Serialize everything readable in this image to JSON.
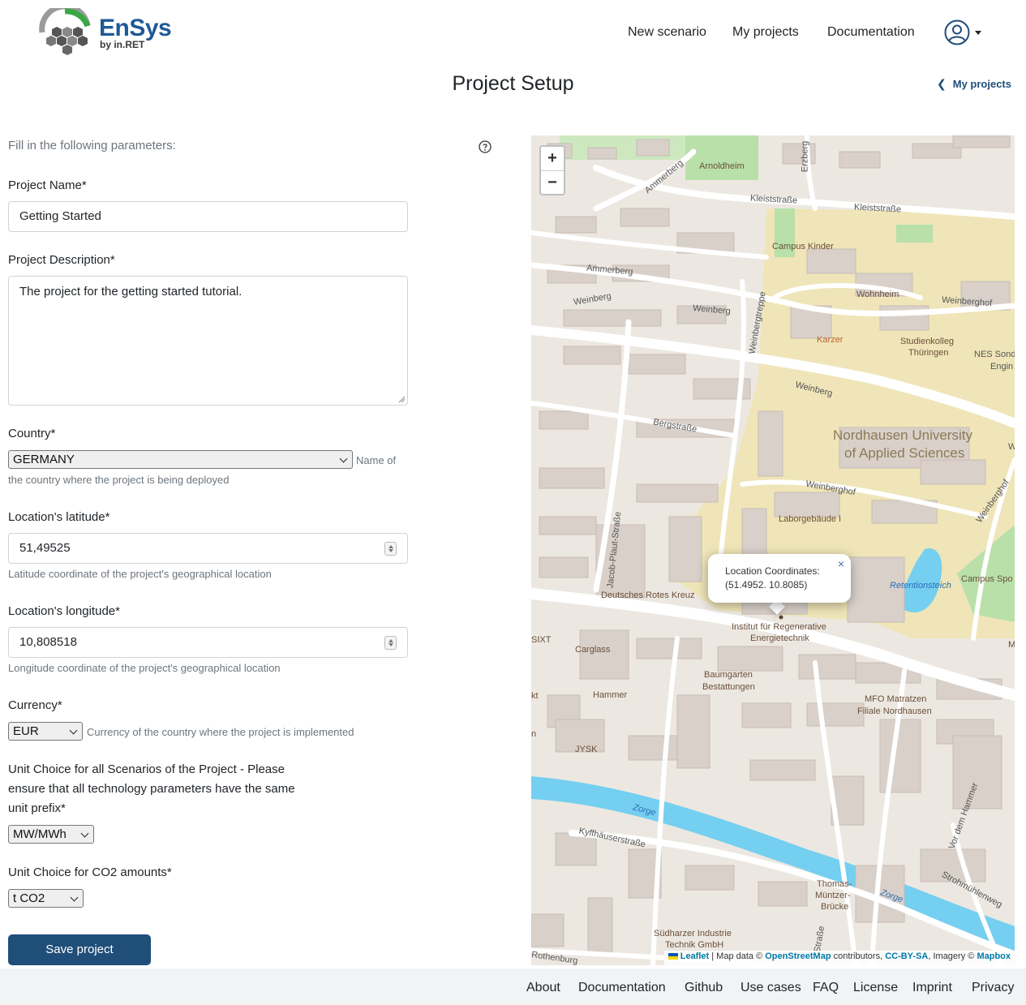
{
  "brand": {
    "name": "EnSys",
    "sub": "by in.RET"
  },
  "nav": {
    "new_scenario": "New scenario",
    "my_projects": "My projects",
    "documentation": "Documentation"
  },
  "page": {
    "title": "Project Setup",
    "back_link": "My projects"
  },
  "form": {
    "intro": "Fill in the following parameters:",
    "project_name": {
      "label": "Project Name*",
      "value": "Getting Started"
    },
    "project_description": {
      "label": "Project Description*",
      "value": "The project for the getting started tutorial."
    },
    "country": {
      "label": "Country*",
      "value": "GERMANY",
      "hint_1": "Name of",
      "hint_2": "the country where the project is being deployed"
    },
    "latitude": {
      "label": "Location's latitude*",
      "value": "51,49525",
      "hint": "Latitude coordinate of the project's geographical location"
    },
    "longitude": {
      "label": "Location's longitude*",
      "value": "10,808518",
      "hint": "Longitude coordinate of the project's geographical location"
    },
    "currency": {
      "label": "Currency*",
      "value": "EUR",
      "hint": "Currency of the country where the project is implemented"
    },
    "unit_choice": {
      "label_1": "Unit Choice for all Scenarios of the Project - Please",
      "label_2": "ensure that all technology parameters have the same",
      "label_3": "unit prefix*",
      "value": "MW/MWh"
    },
    "co2_unit": {
      "label": "Unit Choice for CO2 amounts*",
      "value": "t CO2"
    },
    "save_label": "Save project"
  },
  "map": {
    "zoom_in": "+",
    "zoom_out": "−",
    "popup_title": "Location Coordinates:",
    "popup_coords": "(51.4952. 10.8085)",
    "popup_close": "×",
    "attribution": {
      "leaflet": "Leaflet",
      "text_1": " | Map data © ",
      "osm": "OpenStreetMap",
      "text_2": " contributors, ",
      "license": "CC-BY-SA",
      "text_3": ", Imagery © ",
      "mapbox": "Mapbox"
    },
    "labels": {
      "arnoldheim": "Arnoldheim",
      "ammerberg_1": "Ammerberg",
      "ammerberg_2": "Ammerberg",
      "erzberg": "Erzberg",
      "kleiststrasse_1": "Kleiststraße",
      "kleiststrasse_2": "Kleiststraße",
      "campus_kinder": "Campus Kinder",
      "wohnheim": "Wohnheim",
      "weinberghof_1": "Weinberghof",
      "weinberg_1": "Weinberg",
      "weinberg_2": "Weinberg",
      "weinbergtreppe": "Weinbergtreppe",
      "karzer": "Karzer",
      "studienkolleg_1": "Studienkolleg",
      "studienkolleg_2": "Thüringen",
      "nes_1": "NES Sond",
      "nes_2": "Engin",
      "weinberg_3": "Weinberg",
      "bergstrasse": "Bergstraße",
      "university_1": "Nordhausen University",
      "university_2": "of Applied Sciences",
      "weinberghof_2": "Weinberghof",
      "weinberghof_3": "Weinberghof",
      "laborgebaeude": "Laborgebäude I",
      "jacob_plaut": "Jacob-Plaut-Straße",
      "drk": "Deutsches Rotes Kreuz",
      "retentionsteich": "Retentionsteich",
      "campus_sport": "Campus Spo",
      "institut_1": "Institut für Regenerative",
      "institut_2": "Energietechnik",
      "sixt": "SIXT",
      "carglass": "Carglass",
      "baumgarten_1": "Baumgarten",
      "baumgarten_2": "Bestattungen",
      "mfo_1": "MFO Matratzen",
      "mfo_2": "Filiale Nordhausen",
      "hammer": "Hammer",
      "jysk": "JYSK",
      "zorge_1": "Zorge",
      "zorge_2": "Zorge",
      "kyffhaeuser": "Kyffhäuserstraße",
      "vor_dem_hammer": "Vor dem Hammer",
      "strohmuehlenweg": "Strohmühlenweg",
      "thomas_1": "Thomas-",
      "thomas_2": "Müntzer-",
      "thomas_3": "Brücke",
      "suedharzer_1": "Südharzer Industrie",
      "suedharzer_2": "Technik GmbH",
      "rothenburg": "Rothenburg",
      "strasse": "Straße",
      "kt": "kt",
      "n": "n",
      "m": "M",
      "w": "W"
    }
  },
  "footer": {
    "about": "About",
    "documentation": "Documentation",
    "github": "Github",
    "use_cases": "Use cases",
    "faq": "FAQ",
    "license": "License",
    "imprint": "Imprint",
    "privacy": "Privacy"
  },
  "colors": {
    "primary": "#1f4e79",
    "brand_blue": "#1f5a96",
    "brand_green": "#3aa845",
    "campus": "#efe5b8",
    "water": "#75cff0",
    "park": "#b8e0a8"
  }
}
